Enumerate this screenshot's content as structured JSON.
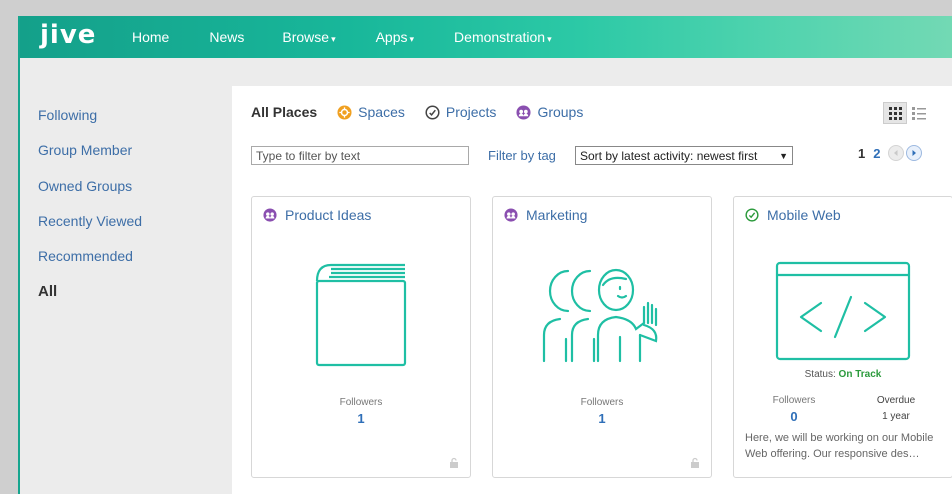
{
  "app": {
    "logo": "jive"
  },
  "nav": {
    "items": [
      {
        "label": "Home"
      },
      {
        "label": "News"
      },
      {
        "label": "Browse",
        "caret": "▾"
      },
      {
        "label": "Apps",
        "caret": "▾"
      },
      {
        "label": "Demonstration",
        "caret": "▾"
      }
    ]
  },
  "sidebar": {
    "items": [
      {
        "label": "Following"
      },
      {
        "label": "Group Member"
      },
      {
        "label": "Owned Groups"
      },
      {
        "label": "Recently Viewed"
      },
      {
        "label": "Recommended"
      },
      {
        "label": "All",
        "active": true
      }
    ]
  },
  "tabs": [
    {
      "label": "All Places",
      "active": true
    },
    {
      "label": "Spaces",
      "icon": "spaces-icon"
    },
    {
      "label": "Projects",
      "icon": "projects-icon"
    },
    {
      "label": "Groups",
      "icon": "groups-icon"
    }
  ],
  "filter": {
    "placeholder": "Type to filter by text",
    "tag_label": "Filter by tag",
    "sort_value": "Sort by latest activity: newest first",
    "sort_caret": "▼"
  },
  "pager": {
    "current": "1",
    "next": "2"
  },
  "cards": [
    {
      "title": "Product Ideas",
      "type": "group",
      "illustration": "book-illustration",
      "followers_label": "Followers",
      "followers": "1"
    },
    {
      "title": "Marketing",
      "type": "group",
      "illustration": "people-illustration",
      "followers_label": "Followers",
      "followers": "1"
    },
    {
      "title": "Mobile Web",
      "type": "project",
      "illustration": "code-window-illustration",
      "status_label": "Status:",
      "status_value": "On Track",
      "followers_label": "Followers",
      "followers": "0",
      "overdue_label": "Overdue",
      "overdue_value": "1 year",
      "description": "Here, we will be working on our Mobile Web offering. Our responsive des…"
    }
  ],
  "colors": {
    "nav_gradient_start": "#14a08a",
    "nav_gradient_end": "#73d9b4",
    "link": "#3d6ea7",
    "illustration": "#1fbfa4",
    "group_icon": "#8a4fb0",
    "space_icon": "#f0a020",
    "status_ok": "#2b9a3c"
  }
}
